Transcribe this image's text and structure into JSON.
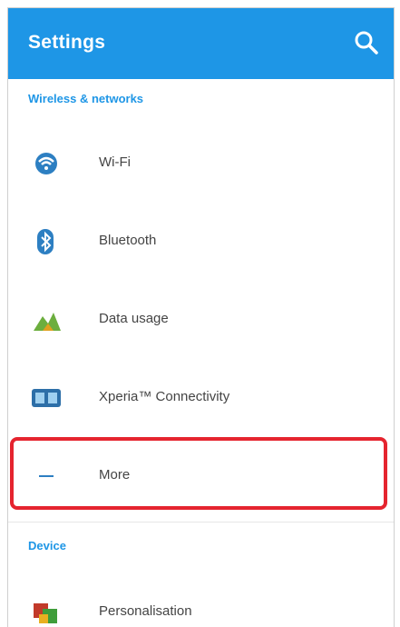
{
  "appbar": {
    "title": "Settings",
    "search_icon": "search-icon",
    "color": "#1e96e6"
  },
  "sections": [
    {
      "header": "Wireless & networks"
    },
    {
      "header": "Device"
    }
  ],
  "items": [
    {
      "label": "Wi-Fi",
      "icon": "wifi-icon"
    },
    {
      "label": "Bluetooth",
      "icon": "bluetooth-icon"
    },
    {
      "label": "Data usage",
      "icon": "data-usage-icon"
    },
    {
      "label": "Xperia™ Connectivity",
      "icon": "xperia-connectivity-icon"
    },
    {
      "label": "More",
      "icon": "more-icon"
    },
    {
      "label": "Personalisation",
      "icon": "personalisation-icon"
    }
  ],
  "highlight_color": "#e5242f"
}
